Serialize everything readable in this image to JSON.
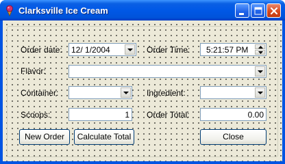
{
  "window": {
    "title": "Clarksville Ice Cream",
    "controls": [
      "minimize",
      "maximize",
      "close"
    ]
  },
  "form": {
    "order_date": {
      "label": "Order date:",
      "value": "12/  1/2004"
    },
    "order_time": {
      "label": "Order Time:",
      "value": "5:21:57 PM"
    },
    "flavor": {
      "label": "Flavor:",
      "value": ""
    },
    "container": {
      "label": "Container:",
      "value": ""
    },
    "ingredient": {
      "label": "Ingredient:",
      "value": ""
    },
    "scoops": {
      "label": "Scoops:",
      "value": "1"
    },
    "order_total": {
      "label": "Order Total:",
      "value": "0.00"
    }
  },
  "buttons": {
    "new_order": "New Order",
    "calculate_total": "Calculate Total",
    "close": "Close"
  }
}
